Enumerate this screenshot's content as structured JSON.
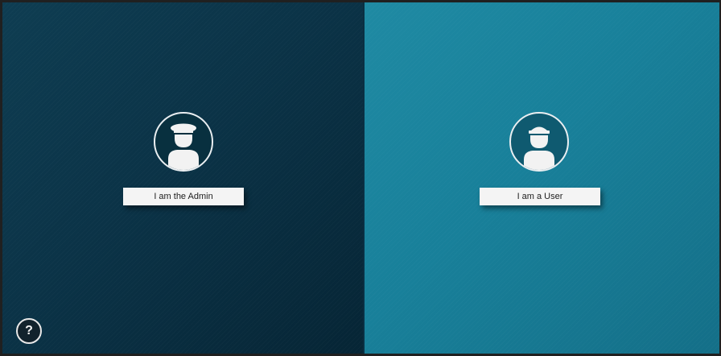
{
  "admin": {
    "button_label": "I am the Admin",
    "avatar_icon": "admin-officer-icon",
    "panel_color": "#0b3347"
  },
  "user": {
    "button_label": "I am a User",
    "avatar_icon": "user-sailor-icon",
    "panel_color": "#18809a"
  },
  "help": {
    "label": "?",
    "icon": "help-icon"
  }
}
